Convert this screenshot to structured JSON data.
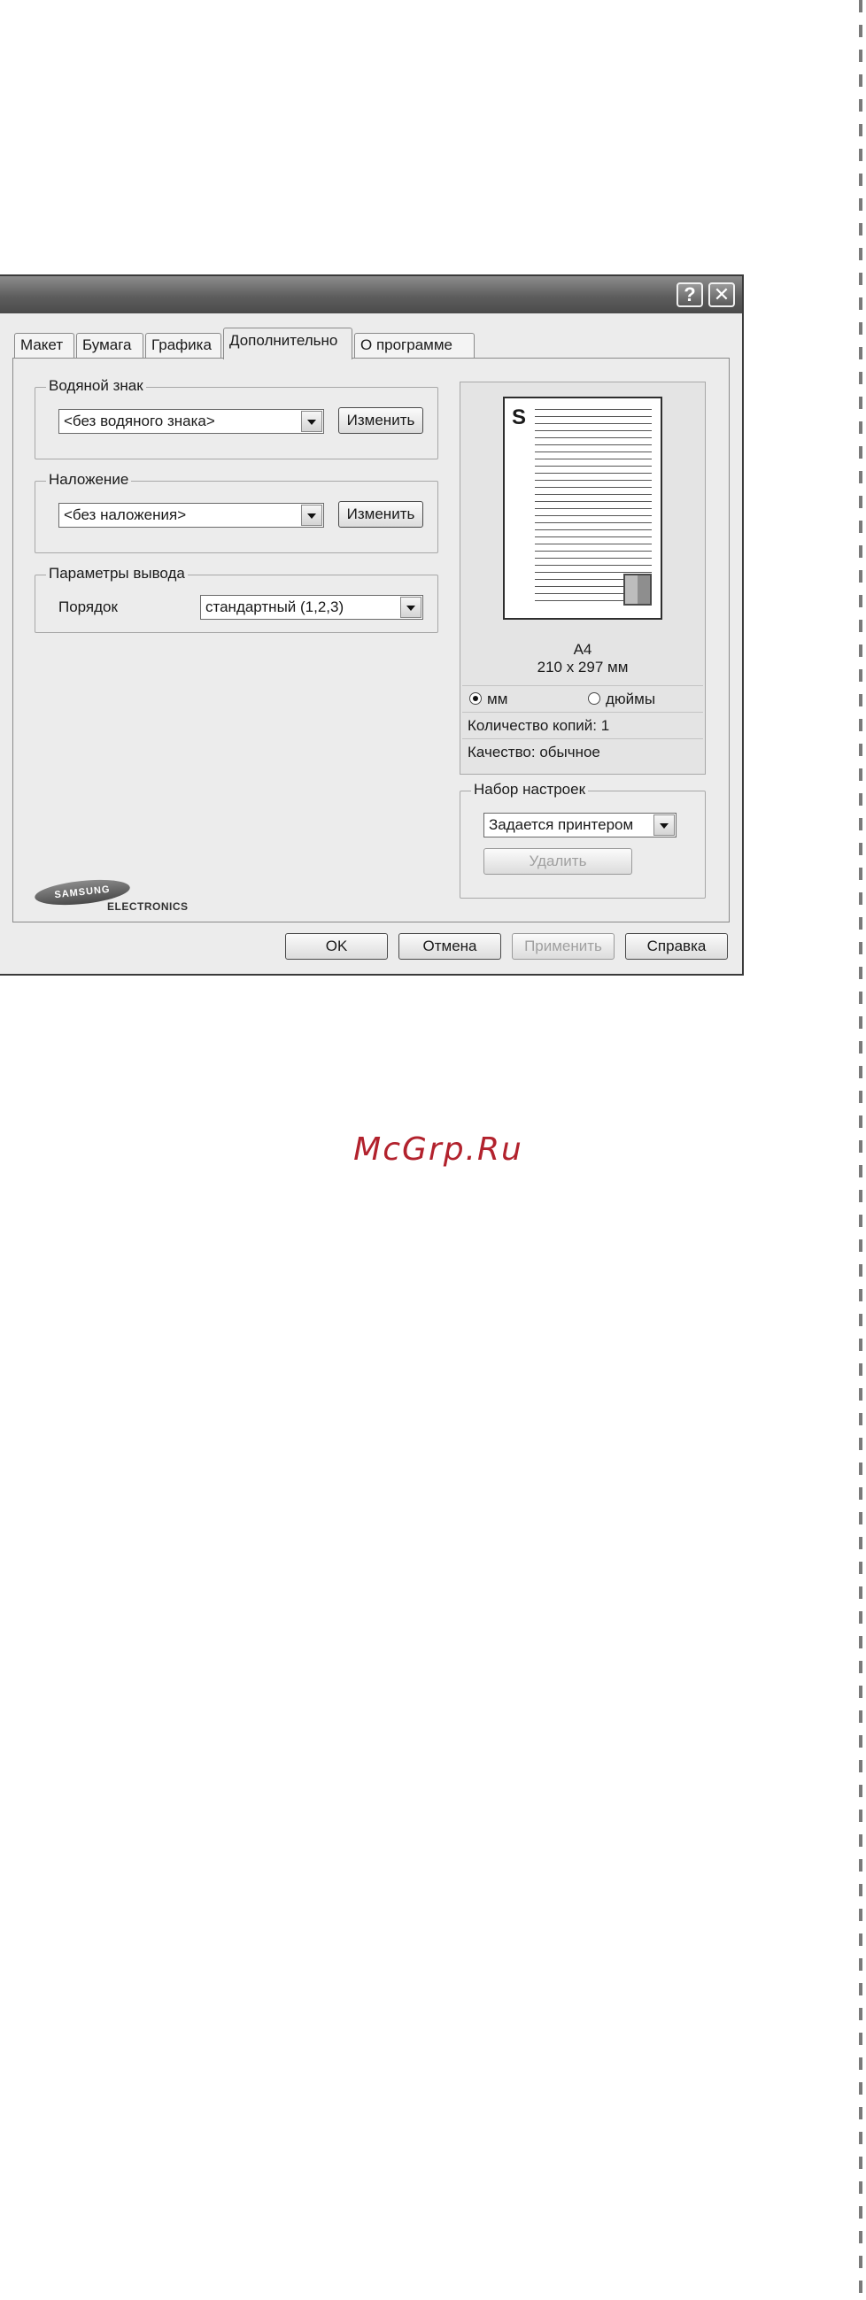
{
  "titlebar": {
    "help_label": "?",
    "close_label": "✕"
  },
  "tabs": [
    {
      "label": "Макет"
    },
    {
      "label": "Бумага"
    },
    {
      "label": "Графика"
    },
    {
      "label": "Дополнительно",
      "active": true
    },
    {
      "label": "О программе"
    }
  ],
  "watermark": {
    "title": "Водяной знак",
    "value": "<без водяного знака>",
    "edit_label": "Изменить"
  },
  "overlay": {
    "title": "Наложение",
    "value": "<без наложения>",
    "edit_label": "Изменить"
  },
  "output": {
    "title": "Параметры вывода",
    "order_label": "Порядок",
    "order_value": "стандартный (1,2,3)"
  },
  "preview": {
    "paper_letter": "S",
    "paper_size": "A4",
    "paper_dims": "210 x 297 мм",
    "unit_mm": "мм",
    "unit_in": "дюймы",
    "selected_unit": "мм",
    "copies": "Количество копий: 1",
    "quality": "Качество: обычное"
  },
  "presets": {
    "title": "Набор настроек",
    "value": "Задается принтером",
    "delete_label": "Удалить"
  },
  "brand": {
    "logo": "SAMSUNG",
    "sub": "ELECTRONICS"
  },
  "footer": {
    "ok": "OK",
    "cancel": "Отмена",
    "apply": "Применить",
    "help": "Справка"
  },
  "site_watermark": "McGrp.Ru"
}
